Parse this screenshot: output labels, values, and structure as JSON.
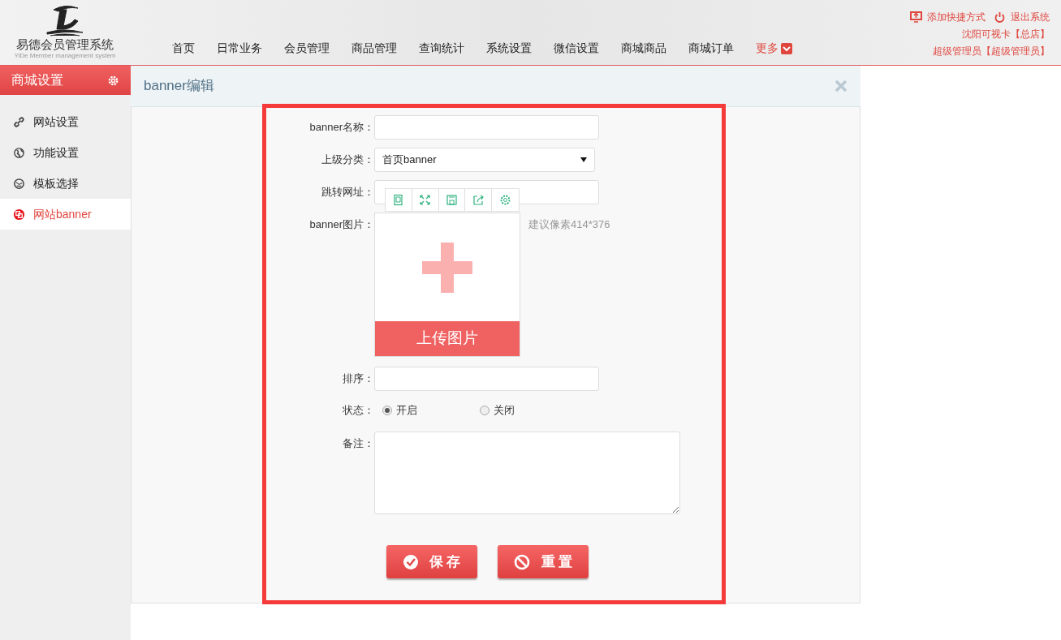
{
  "header": {
    "logo_title": "易德会员管理系统",
    "logo_subtitle": "YiDe Member management system",
    "nav": [
      {
        "label": "首页",
        "kind": "plain"
      },
      {
        "label": "日常业务",
        "kind": "plain"
      },
      {
        "label": "会员管理",
        "kind": "plain"
      },
      {
        "label": "商品管理",
        "kind": "plain"
      },
      {
        "label": "查询统计",
        "kind": "plain"
      },
      {
        "label": "系统设置",
        "kind": "plain"
      },
      {
        "label": "微信设置",
        "kind": "plain"
      },
      {
        "label": "商城商品",
        "kind": "plain"
      },
      {
        "label": "商城订单",
        "kind": "plain"
      },
      {
        "label": "更多",
        "kind": "more"
      }
    ],
    "links": [
      {
        "label": "添加快捷方式",
        "kind": "shortcut"
      },
      {
        "label": "退出系统",
        "kind": "logout"
      }
    ],
    "store": "沈阳可视卡【总店】",
    "user": "超级管理员【超级管理员】"
  },
  "sidebar": {
    "title": "商城设置",
    "items": [
      {
        "label": "网站设置",
        "kind": "link",
        "selected": false
      },
      {
        "label": "功能设置",
        "kind": "globe",
        "selected": false
      },
      {
        "label": "模板选择",
        "kind": "template",
        "selected": false
      },
      {
        "label": "网站banner",
        "kind": "banner",
        "selected": true
      }
    ]
  },
  "panel": {
    "title": "banner编辑",
    "fields": [
      {
        "kind": "text",
        "label": "banner名称："
      },
      {
        "kind": "select",
        "label": "上级分类：",
        "value": "首页banner"
      },
      {
        "kind": "text",
        "label": "跳转网址："
      },
      {
        "kind": "image",
        "label": "banner图片：",
        "upload_label": "上传图片",
        "hint": "建议像素414*376"
      },
      {
        "kind": "text",
        "label": "排序："
      },
      {
        "kind": "radio",
        "label": "状态：",
        "options": [
          {
            "label": "开启",
            "selected": true
          },
          {
            "label": "关闭",
            "selected": false
          }
        ]
      },
      {
        "kind": "textarea",
        "label": "备注："
      }
    ],
    "buttons": [
      {
        "label": "保 存",
        "kind": "save"
      },
      {
        "label": "重 置",
        "kind": "reset"
      }
    ]
  }
}
